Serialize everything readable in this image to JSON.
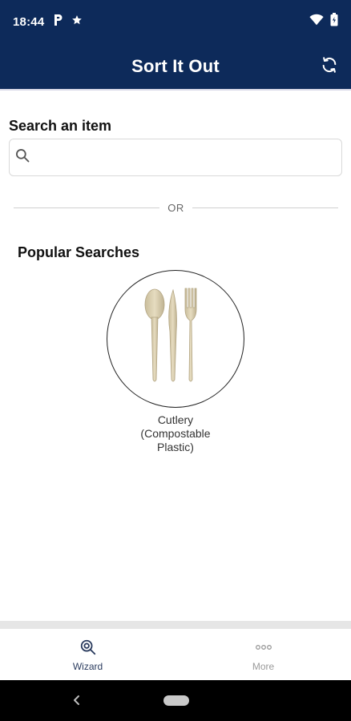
{
  "status_bar": {
    "time": "18:44",
    "left_icons": [
      "parking-icon",
      "star-icon"
    ],
    "right_icons": [
      "wifi-icon",
      "battery-icon"
    ]
  },
  "app_bar": {
    "title": "Sort It Out",
    "action_icon": "refresh-icon",
    "background_color": "#0d2a5a"
  },
  "search": {
    "label": "Search an item",
    "placeholder": "",
    "value": "",
    "icon": "search-icon"
  },
  "divider": {
    "text": "OR"
  },
  "popular": {
    "title": "Popular Searches",
    "items": [
      {
        "caption_lines": [
          "Cutlery",
          "(Compostable",
          "Plastic)"
        ],
        "image": "compostable-cutlery"
      }
    ]
  },
  "bottom_nav": {
    "items": [
      {
        "label": "Wizard",
        "icon": "wizard-search-icon",
        "active": true
      },
      {
        "label": "More",
        "icon": "more-dots-icon",
        "active": false
      }
    ],
    "active_color": "#2a3b5e",
    "inactive_color": "#9a9a9a"
  },
  "system_nav": {
    "buttons": [
      "back-icon",
      "home-pill"
    ]
  }
}
